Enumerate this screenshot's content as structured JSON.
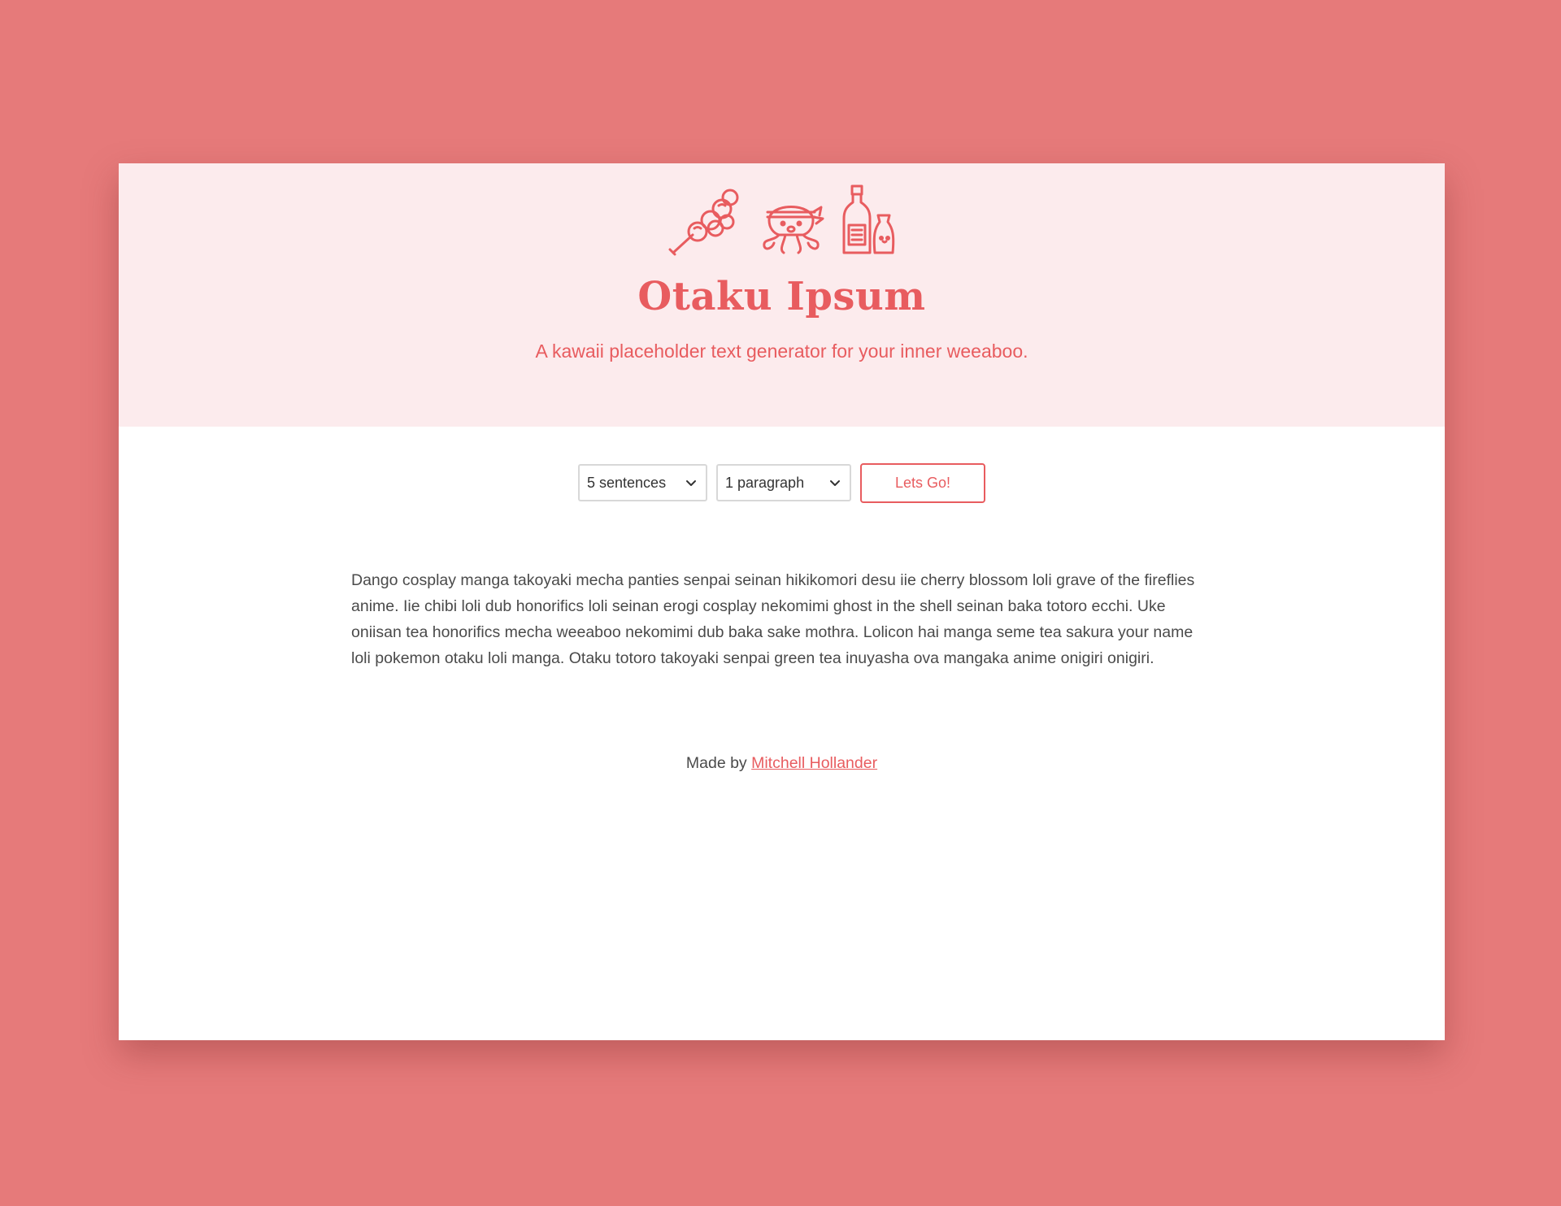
{
  "colors": {
    "background": "#e67a7a",
    "hero": "#fcebed",
    "accent": "#e85c5f",
    "text": "#4a4a4a"
  },
  "hero": {
    "icons": [
      "dango-icon",
      "octopus-icon",
      "sake-icon"
    ],
    "title": "Otaku Ipsum",
    "subtitle": "A kawaii placeholder text generator for your inner weeaboo."
  },
  "controls": {
    "sentences": {
      "selected": "5 sentences",
      "icon": "chevron-down-icon"
    },
    "paragraphs": {
      "selected": "1 paragraph",
      "icon": "chevron-down-icon"
    },
    "go_label": "Lets Go!"
  },
  "output": {
    "text": "Dango cosplay manga takoyaki mecha panties senpai seinan hikikomori desu iie cherry blossom loli grave of the fireflies anime. Iie chibi loli dub honorifics loli seinan erogi cosplay nekomimi ghost in the shell seinan baka totoro ecchi. Uke oniisan tea honorifics mecha weeaboo nekomimi dub baka sake mothra. Lolicon hai manga seme tea sakura your name loli pokemon otaku loli manga. Otaku totoro takoyaki senpai green tea inuyasha ova mangaka anime onigiri onigiri."
  },
  "footer": {
    "prefix": "Made by",
    "author": "Mitchell Hollander"
  }
}
